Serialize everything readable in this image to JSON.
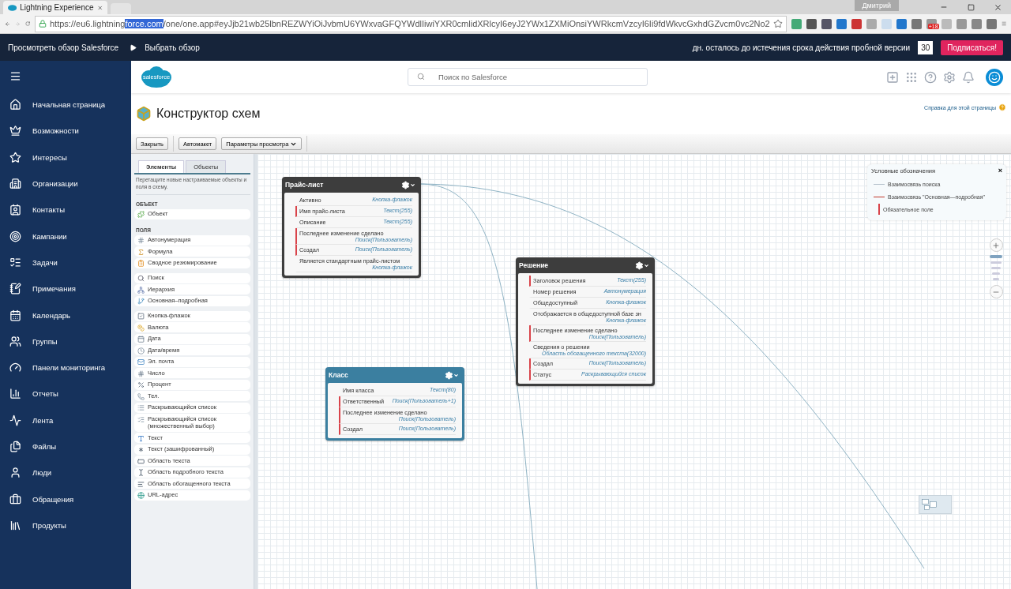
{
  "browser": {
    "tab_title": "Lightning Experience",
    "user": "Дмитрий",
    "url": {
      "before": "https://eu6.lightning",
      "selected": "force.com",
      "after": "/one/one.app#eyJjb21wb25lbnREZWYiOiJvbmU6YWxvaGFQYWdlIiwiYXR0cmlidXRlcyI6eyJ2YWx1ZXMiOnsiYWRkcmVzcyI6Ii9fdWkvcGxhdGZvcm0vc2No2"
    },
    "badge": "+18"
  },
  "trial_bar": {
    "tour": "Просмотреть обзор Salesforce",
    "pick": "Выбрать обзор",
    "message": "дн. осталось до истечения срока действия пробной версии",
    "days": "30",
    "subscribe": "Подписаться!"
  },
  "nav": {
    "items": [
      {
        "label": "Начальная страница"
      },
      {
        "label": "Возможности"
      },
      {
        "label": "Интересы"
      },
      {
        "label": "Организации"
      },
      {
        "label": "Контакты"
      },
      {
        "label": "Кампании"
      },
      {
        "label": "Задачи"
      },
      {
        "label": "Примечания"
      },
      {
        "label": "Календарь"
      },
      {
        "label": "Группы"
      },
      {
        "label": "Панели мониторинга"
      },
      {
        "label": "Отчеты"
      },
      {
        "label": "Лента"
      },
      {
        "label": "Файлы"
      },
      {
        "label": "Люди"
      },
      {
        "label": "Обращения"
      },
      {
        "label": "Продукты"
      }
    ]
  },
  "header": {
    "logo": "salesforce",
    "search": {
      "placeholder": "Поиск по Salesforce"
    }
  },
  "page": {
    "title": "Конструктор схем",
    "help": "Справка для этой страницы"
  },
  "toolbar": {
    "buttons": [
      {
        "label": "Закрыть",
        "dropdown": false
      },
      {
        "label": "Автомакет",
        "dropdown": false
      },
      {
        "label": "Параметры просмотра",
        "dropdown": true
      }
    ]
  },
  "palette": {
    "tabs": [
      {
        "label": "Элементы",
        "selected": true
      },
      {
        "label": "Объекты",
        "selected": false
      }
    ],
    "hint": "Перетащите новые настраиваемые объекты и поля в схему.",
    "sections": [
      {
        "title": "ОБЪЕКТ",
        "groups": [
          [
            "Объект"
          ]
        ]
      },
      {
        "title": "ПОЛЯ",
        "groups": [
          [
            "Автонумерация",
            "Формула",
            "Сводное резюмирование"
          ],
          [
            "Поиск",
            "Иерархия",
            "Основная–подробная"
          ],
          [
            "Кнопка-флажок",
            "Валюта",
            "Дата",
            "Дата/время",
            "Эл. почта",
            "Число",
            "Процент",
            "Тел.",
            "Раскрывающийся список",
            "Раскрывающийся список (множественный выбор)",
            "Текст",
            "Текст (зашифрованный)",
            "Область текста",
            "Область подробного текста",
            "Область обогащенного текста",
            "URL-адрес"
          ]
        ]
      }
    ]
  },
  "canvas": {
    "nodes": [
      {
        "title": "Прайс-лист",
        "kind": "standard",
        "fields": [
          {
            "name": "Активно",
            "type": "Кнопка-флажок",
            "required": false
          },
          {
            "name": "Имя прайс-листа",
            "type": "Текст(255)",
            "required": true
          },
          {
            "name": "Описание",
            "type": "Текст(255)",
            "required": false
          },
          {
            "name": "Последнее изменение сделано",
            "type": "Поиск(Пользователь)",
            "required": true
          },
          {
            "name": "Создал",
            "type": "Поиск(Пользователь)",
            "required": true
          },
          {
            "name": "Является стандартным прайс-листом",
            "type": "Кнопка-флажок",
            "required": false
          }
        ]
      },
      {
        "title": "Решение",
        "kind": "standard",
        "fields": [
          {
            "name": "Заголовок решения",
            "type": "Текст(255)",
            "required": true
          },
          {
            "name": "Номер решения",
            "type": "Автонумерация",
            "required": false
          },
          {
            "name": "Общедоступный",
            "type": "Кнопка-флажок",
            "required": false
          },
          {
            "name": "Отображается в общедоступной базе зн",
            "type": "Кнопка-флажок",
            "required": false
          },
          {
            "name": "Последнее изменение сделано",
            "type": "Поиск(Пользователь)",
            "required": true
          },
          {
            "name": "Сведения о решении",
            "type": "Область обогащенного текста(32000)",
            "required": false
          },
          {
            "name": "Создал",
            "type": "Поиск(Пользователь)",
            "required": true
          },
          {
            "name": "Статус",
            "type": "Раскрывающийся список",
            "required": true
          }
        ]
      },
      {
        "title": "Класс",
        "kind": "custom",
        "fields": [
          {
            "name": "Имя класса",
            "type": "Текст(80)",
            "required": false
          },
          {
            "name": "Ответственный",
            "type": "Поиск(Пользователь+1)",
            "required": true
          },
          {
            "name": "Последнее изменение сделано",
            "type": "Поиск(Пользователь)",
            "required": true
          },
          {
            "name": "Создал",
            "type": "Поиск(Пользователь)",
            "required": true
          }
        ]
      }
    ],
    "legend": {
      "title": "Условные обозначения",
      "close": "×",
      "items": [
        {
          "kind": "lookup",
          "label": "Взаимосвязь поиска"
        },
        {
          "kind": "master",
          "label": "Взаимосвязь \"Основная—подробная\""
        },
        {
          "kind": "required",
          "label": "Обязательное поле"
        }
      ]
    }
  }
}
